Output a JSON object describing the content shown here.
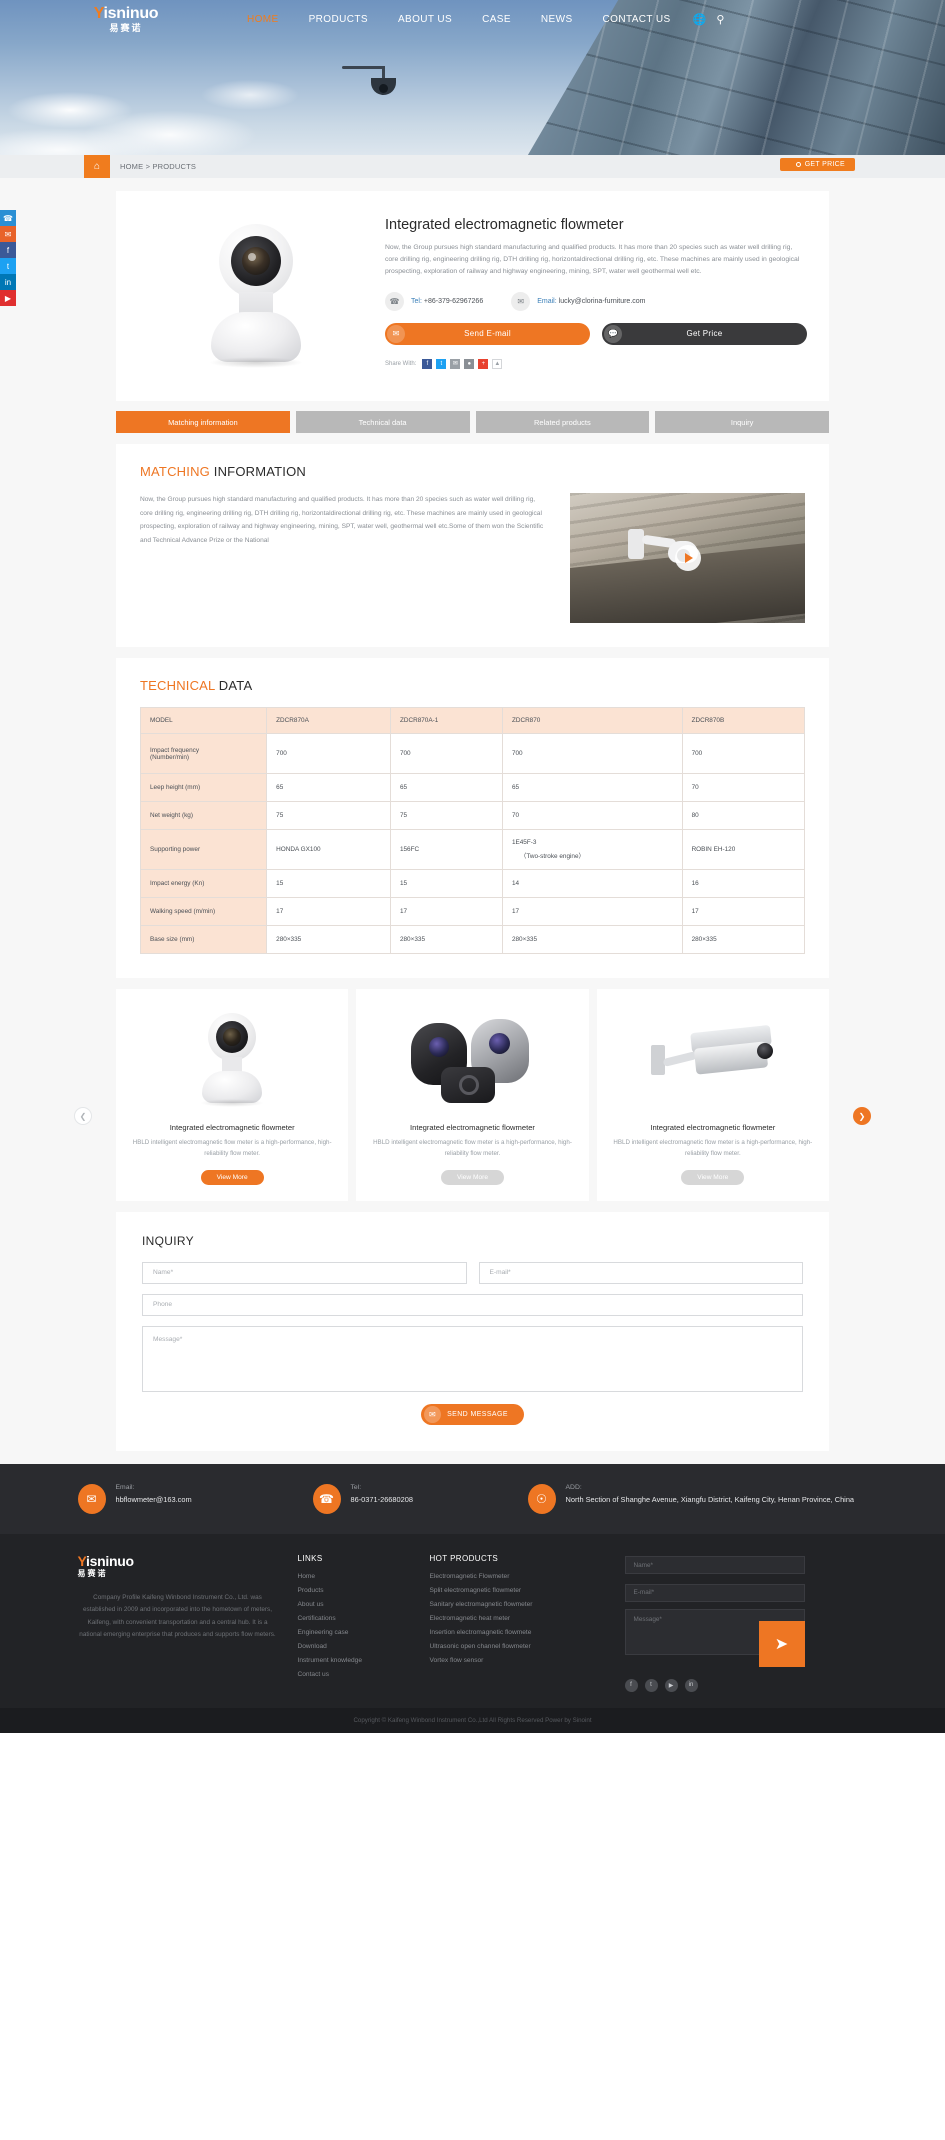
{
  "brand": {
    "logo_main": "isninuo",
    "logo_y": "Y",
    "logo_cn": "易赛诺"
  },
  "nav": {
    "items": [
      {
        "label": "HOME",
        "active": true
      },
      {
        "label": "PRODUCTS",
        "active": false
      },
      {
        "label": "ABOUT US",
        "active": false
      },
      {
        "label": "CASE",
        "active": false
      },
      {
        "label": "NEWS",
        "active": false
      },
      {
        "label": "CONTACT US",
        "active": false
      }
    ],
    "globe_icon": "globe-icon",
    "search_icon": "search-icon"
  },
  "breadcrumb": {
    "home_icon": "home-icon",
    "text": "HOME > PRODUCTS",
    "get_price": "GET PRICE"
  },
  "siderail": [
    {
      "name": "phone-icon",
      "glyph": "✆"
    },
    {
      "name": "email-icon",
      "glyph": "✉"
    },
    {
      "name": "facebook-icon",
      "glyph": "f"
    },
    {
      "name": "twitter-icon",
      "glyph": "t"
    },
    {
      "name": "linkedin-icon",
      "glyph": "in"
    },
    {
      "name": "youtube-icon",
      "glyph": "▶"
    }
  ],
  "product": {
    "title": "Integrated electromagnetic flowmeter",
    "description": "Now, the Group pursues high standard manufacturing and qualified products. It has more than 20 species such as water well drilling rig, core drilling rig, engineering drilling rig, DTH drilling rig, horizontaldirectional drilling rig, etc. These machines are mainly used in geological prospecting, exploration of railway and highway engineering, mining, SPT, water well geothermal well etc.",
    "tel_label": "Tel:",
    "tel_value": "+86-379-62967266",
    "email_label": "Email:",
    "email_value": "lucky@clorina-furniture.com",
    "send_email_btn": "Send E-mail",
    "get_price_btn": "Get Price",
    "share_label": "Share With:"
  },
  "tabs": [
    {
      "label": "Matching information",
      "active": true
    },
    {
      "label": "Technical data",
      "active": false
    },
    {
      "label": "Related products",
      "active": false
    },
    {
      "label": "Inquiry",
      "active": false
    }
  ],
  "matching": {
    "title_hl": "MATCHING",
    "title_rest": " INFORMATION",
    "body": "Now, the Group pursues high standard manufacturing and qualified products. It has more than 20 species such as water well drilling rig, core drilling rig, engineering drilling rig, DTH drilling rig, horizontaldirectional drilling rig, etc. These machines are mainly used in geological prospecting, exploration of railway and highway engineering, mining, SPT, water well, geothermal well etc.Some of them won the Scientific and Technical Advance Prize or the National"
  },
  "technical": {
    "title_hl": "TECHNICAL",
    "title_rest": " DATA",
    "headers": [
      "MODEL",
      "ZDCR870A",
      "ZDCR870A-1",
      "ZDCR870",
      "ZDCR870B"
    ],
    "rows": [
      {
        "label": "Impact frequency (Number/min)",
        "label_line1": "Impact frequency",
        "label_line2": "(Number/min)",
        "values": [
          "700",
          "700",
          "700",
          "700"
        ]
      },
      {
        "label": "Leep height (mm)",
        "values": [
          "65",
          "65",
          "65",
          "70"
        ]
      },
      {
        "label": "Net weight (kg)",
        "values": [
          "75",
          "75",
          "70",
          "80"
        ]
      },
      {
        "label": "Supporting power",
        "values": [
          "HONDA GX100",
          "156FC",
          "1E45F-3",
          "ROBIN EH-120"
        ],
        "sub3": "（Two-stroke engine）"
      },
      {
        "label": "Impact energy (Kn)",
        "values": [
          "15",
          "15",
          "14",
          "16"
        ]
      },
      {
        "label": "Walking speed (m/min)",
        "values": [
          "17",
          "17",
          "17",
          "17"
        ]
      },
      {
        "label": "Base size (mm)",
        "values": [
          "280×335",
          "280×335",
          "280×335",
          "280×335"
        ]
      }
    ]
  },
  "related": {
    "prev_icon": "chevron-left-icon",
    "next_icon": "chevron-right-icon",
    "cards": [
      {
        "title": "Integrated electromagnetic flowmeter",
        "desc": "HBLD intelligent electromagnetic flow meter is a high-performance, high-reliability flow meter.",
        "btn": "View More",
        "btn_active": true
      },
      {
        "title": "Integrated electromagnetic flowmeter",
        "desc": "HBLD intelligent electromagnetic flow meter is a high-performance, high-reliability flow meter.",
        "btn": "View More",
        "btn_active": false
      },
      {
        "title": "Integrated electromagnetic flowmeter",
        "desc": "HBLD intelligent electromagnetic flow meter is a high-performance, high-reliability flow meter.",
        "btn": "View More",
        "btn_active": false
      }
    ]
  },
  "inquiry": {
    "title": "INQUIRY",
    "name_placeholder": "Name*",
    "email_placeholder": "E-mail*",
    "phone_placeholder": "Phone",
    "message_placeholder": "Message*",
    "submit": "SEND MESSAGE"
  },
  "footer_contact": {
    "email_label": "Email:",
    "email_value": "hbflowmeter@163.com",
    "tel_label": "Tel:",
    "tel_value": "86-0371-26680208",
    "add_label": "ADD:",
    "add_value": "North Section of Shanghe Avenue, Xiangfu District, Kaifeng City, Henan Province, China"
  },
  "footer": {
    "about": "Company Profile Kaifeng Winbond Instrument Co., Ltd. was established in 2009 and incorporated into the hometown of meters, Kaifeng, with convenient transportation and a central hub. It is a national emerging enterprise that produces and supports flow meters.",
    "links_title": "LINKS",
    "links": [
      "Home",
      "Products",
      "About us",
      "Certifications",
      "Engineering case",
      "Download",
      "Instrument knowledge",
      "Contact us"
    ],
    "hot_title": "HOT PRODUCTS",
    "hot_products": [
      "Electromagnetic Flowmeter",
      "Split electromagnetic flowmeter",
      "Sanitary electromagnetic flowmeter",
      "Electromagnetic heat meter",
      "Insertion electromagnetic flowmete",
      "Ultrasonic open channel flowmeter",
      "Vortex flow sensor"
    ],
    "form": {
      "name_placeholder": "Name*",
      "email_placeholder": "E-mail*",
      "message_placeholder": "Message*",
      "submit_icon": "send-icon"
    },
    "social": [
      {
        "name": "facebook-icon",
        "glyph": "f"
      },
      {
        "name": "twitter-icon",
        "glyph": "t"
      },
      {
        "name": "youtube-icon",
        "glyph": "▶"
      },
      {
        "name": "linkedin-icon",
        "glyph": "in"
      }
    ],
    "copyright": "Copyright © Kaifeng Winbond Instrument Co.,Ltd All Rights Reserved   Power by Sinoint"
  },
  "colors": {
    "accent": "#ee7623",
    "dark": "#2a2b2f",
    "table_head": "#fbe3d3"
  }
}
